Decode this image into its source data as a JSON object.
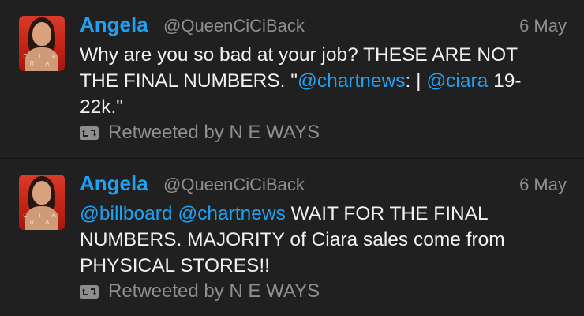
{
  "tweets": [
    {
      "name": "Angela",
      "handle": "@QueenCiCiBack",
      "date": "6 May",
      "avatar_label": "C I A R A",
      "text_parts": [
        {
          "text": "Why are you so bad at your job? THESE ARE NOT THE FINAL NUMBERS. \"",
          "mention": false
        },
        {
          "text": "@chartnews",
          "mention": true
        },
        {
          "text": ": | ",
          "mention": false
        },
        {
          "text": "@ciara",
          "mention": true
        },
        {
          "text": "  19-22k.\"",
          "mention": false
        }
      ],
      "retweet_icon": "retweet-icon",
      "retweet_label": "Retweeted by N E WAYS"
    },
    {
      "name": "Angela",
      "handle": "@QueenCiCiBack",
      "date": "6 May",
      "avatar_label": "C I A R A",
      "text_parts": [
        {
          "text": "@billboard",
          "mention": true
        },
        {
          "text": " ",
          "mention": false
        },
        {
          "text": "@chartnews",
          "mention": true
        },
        {
          "text": " WAIT FOR THE FINAL NUMBERS. MAJORITY of Ciara sales come from PHYSICAL STORES!!",
          "mention": false
        }
      ],
      "retweet_icon": "retweet-icon",
      "retweet_label": "Retweeted by N E WAYS"
    }
  ],
  "colors": {
    "background": "#1f1f1f",
    "name": "#1ea1f2",
    "mention": "#1ea1f2",
    "text": "#f2f2f2",
    "meta": "#8e8e8e"
  }
}
